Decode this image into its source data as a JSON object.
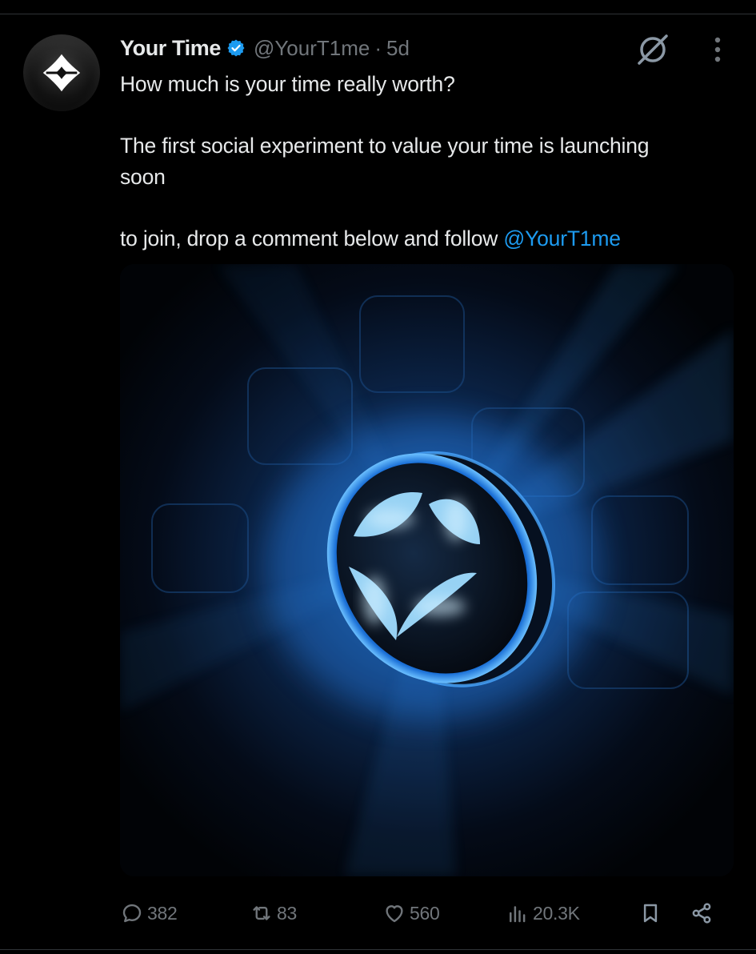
{
  "tweet": {
    "author_name": "Your Time",
    "handle": "@YourT1me",
    "separator": "·",
    "timestamp": "5d",
    "lines": [
      "How much is your time really worth?",
      "The first social experiment to value your time is launching",
      "soon",
      "to join, drop a comment below and follow "
    ],
    "mention": "@YourT1me"
  },
  "actions": {
    "replies": "382",
    "reposts": "83",
    "likes": "560",
    "views": "20.3K"
  },
  "icons": {
    "verified": "verified-badge-icon",
    "grok": "grok-icon",
    "more": "more-icon",
    "reply": "reply-icon",
    "repost": "repost-icon",
    "like": "heart-icon",
    "views": "views-icon",
    "bookmark": "bookmark-icon",
    "share": "share-icon"
  },
  "colors": {
    "background": "#000000",
    "text": "#e7e9ea",
    "muted": "#71767b",
    "accent": "#1d9bf0",
    "glow": "#3aa0ff"
  }
}
